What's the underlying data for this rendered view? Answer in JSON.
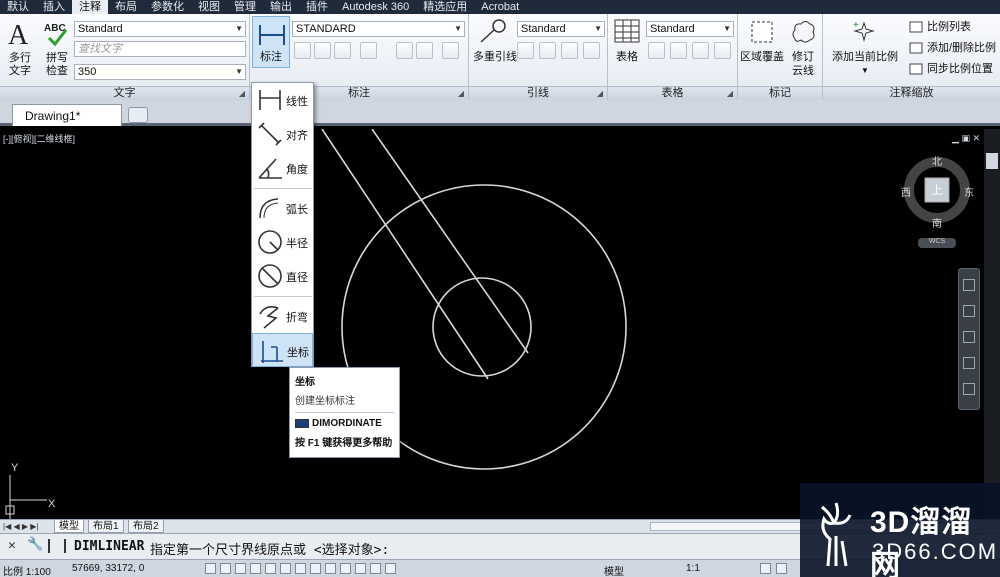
{
  "menubar": {
    "items": [
      "默认",
      "插入",
      "注释",
      "布局",
      "参数化",
      "视图",
      "管理",
      "输出",
      "插件",
      "Autodesk 360",
      "精选应用",
      "Acrobat"
    ],
    "active_index": 2
  },
  "ribbon": {
    "text_panel": {
      "multiline_label_1": "多行",
      "multiline_label_2": "文字",
      "spell_label_1": "拼写",
      "spell_label_2": "检查",
      "style_value": "Standard",
      "find_placeholder": "查找文字",
      "height_value": "350",
      "title": "文字"
    },
    "dim_panel": {
      "big_button_label": "标注",
      "style_value": "STANDARD",
      "title": "标注"
    },
    "leader_panel": {
      "multileader_label": "多重引线",
      "style_value": "Standard",
      "title": "引线"
    },
    "table_panel": {
      "table_label": "表格",
      "style_value": "Standard",
      "title": "表格"
    },
    "markup_panel": {
      "wipeout_label": "区域覆盖",
      "revcloud_label_1": "修订",
      "revcloud_label_2": "云线",
      "title": "标记"
    },
    "scale_panel": {
      "add_current_label": "添加当前比例",
      "scale_list_label": "比例列表",
      "add_delete_label": "添加/删除比例",
      "sync_label": "同步比例位置",
      "title": "注释缩放"
    }
  },
  "doc_tabs": {
    "tab1": "Drawing1*"
  },
  "viewport": {
    "label": "[-][俯视][二维线框]"
  },
  "viewcube": {
    "top_face": "上",
    "north": "北",
    "south": "南",
    "east": "东",
    "west": "西",
    "wcs": "WCS"
  },
  "dim_dropdown": {
    "items": [
      "线性",
      "对齐",
      "角度",
      "弧长",
      "半径",
      "直径",
      "折弯",
      "坐标"
    ]
  },
  "tooltip": {
    "title": "坐标",
    "description": "创建坐标标注",
    "command": "DIMORDINATE",
    "help": "按 F1 键获得更多帮助"
  },
  "layout_tabs": {
    "model": "模型",
    "layout1": "布局1",
    "layout2": "布局2"
  },
  "command_line": {
    "command": "DIMLINEAR",
    "prompt": "指定第一个尺寸界线原点或 <选择对象>:"
  },
  "status_bar": {
    "scale": "比例 1:100",
    "coords": "57669, 33172, 0",
    "model": "模型",
    "anno_scale": "1:1"
  },
  "watermark": {
    "text_cn": "3D溜溜网",
    "text_url": "3D66.COM"
  },
  "colors": {
    "accent": "#1f2a3a",
    "highlight": "#cfe3f7",
    "canvas": "#000000"
  }
}
